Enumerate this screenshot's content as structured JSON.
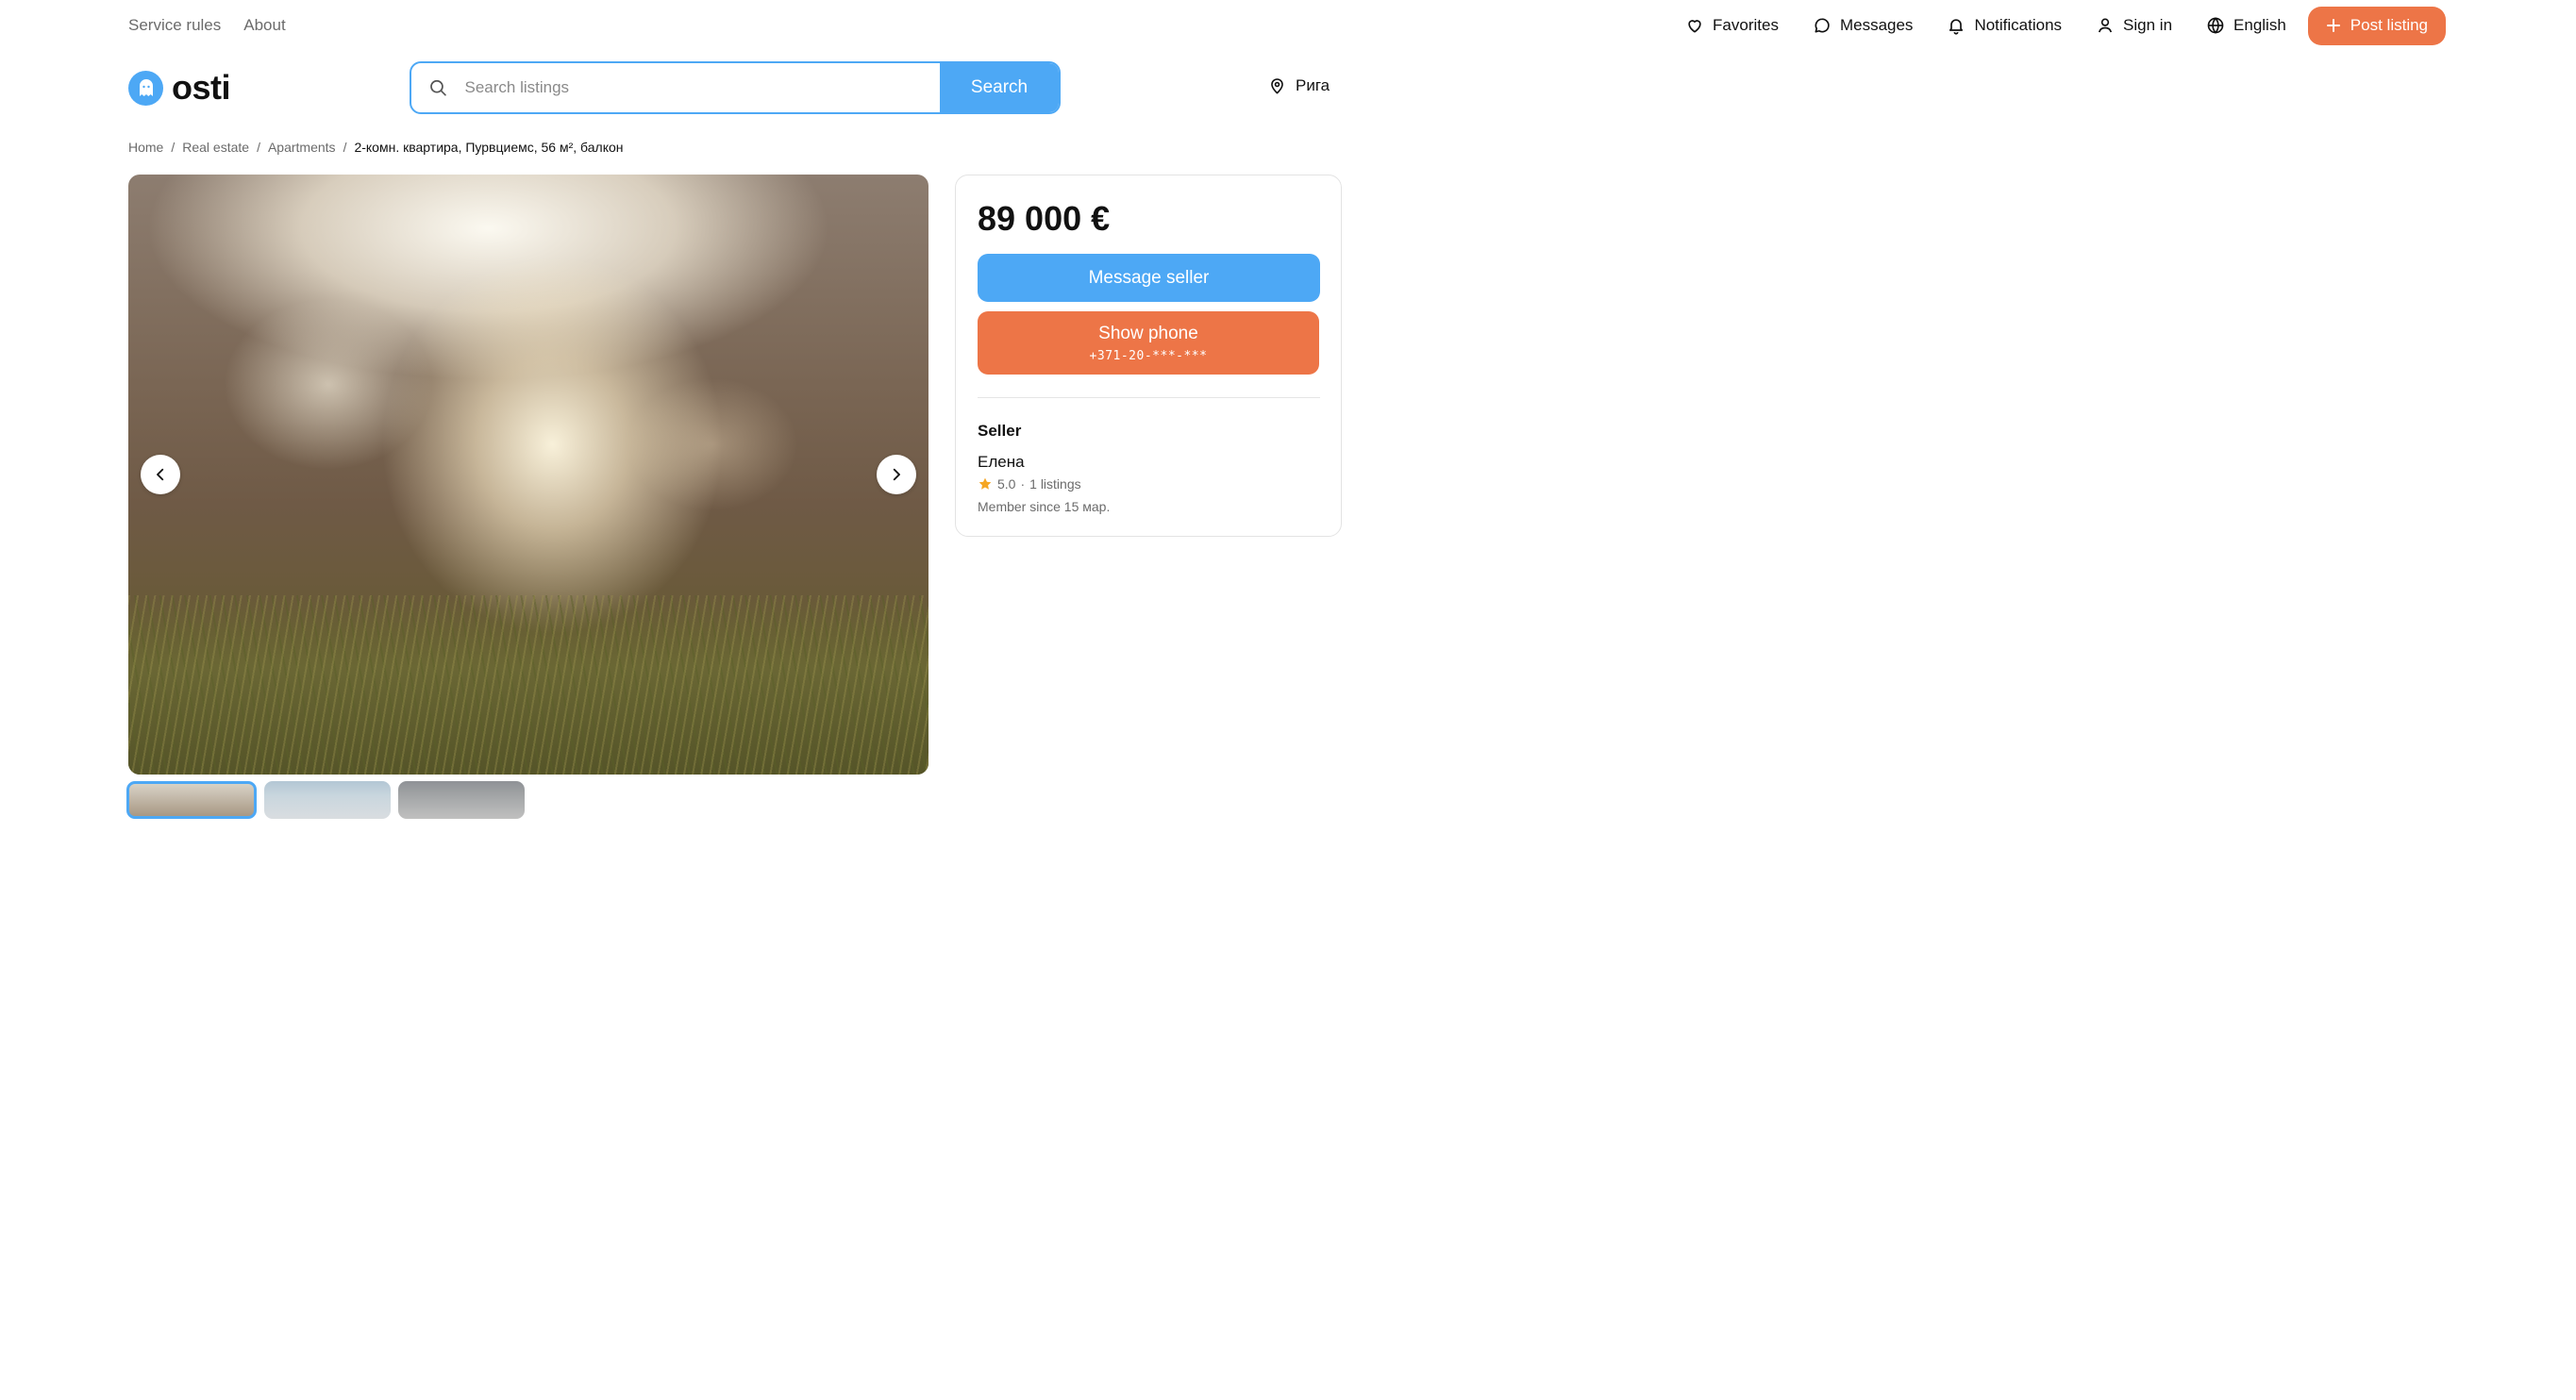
{
  "top_nav": {
    "left_links": [
      {
        "label": "Service rules"
      },
      {
        "label": "About"
      }
    ],
    "favorites": "Favorites",
    "messages": "Messages",
    "notifications": "Notifications",
    "sign_in": "Sign in",
    "language": "English",
    "post_listing": "Post listing"
  },
  "header": {
    "logo_text": "osti",
    "search_placeholder": "Search listings",
    "search_button": "Search",
    "location": "Рига"
  },
  "breadcrumb": {
    "items": [
      "Home",
      "Real estate",
      "Apartments"
    ],
    "separator": "/",
    "current": "2-комн. квартира, Пурвциемс, 56 м², балкон"
  },
  "gallery": {
    "thumbnail_count": 3,
    "selected_thumbnail": 1
  },
  "listing_card": {
    "price": "89 000 €",
    "message_button": "Message seller",
    "show_phone_button": "Show phone",
    "masked_phone": "+371-20-***-***",
    "seller_heading": "Seller",
    "seller_name": "Елена",
    "rating": "5.0",
    "rating_separator": "·",
    "listings_count": "1 listings",
    "member_since": "Member since 15 мар."
  },
  "colors": {
    "accent_blue": "#4da8f5",
    "accent_orange": "#ed7547",
    "star": "#f5a623"
  }
}
